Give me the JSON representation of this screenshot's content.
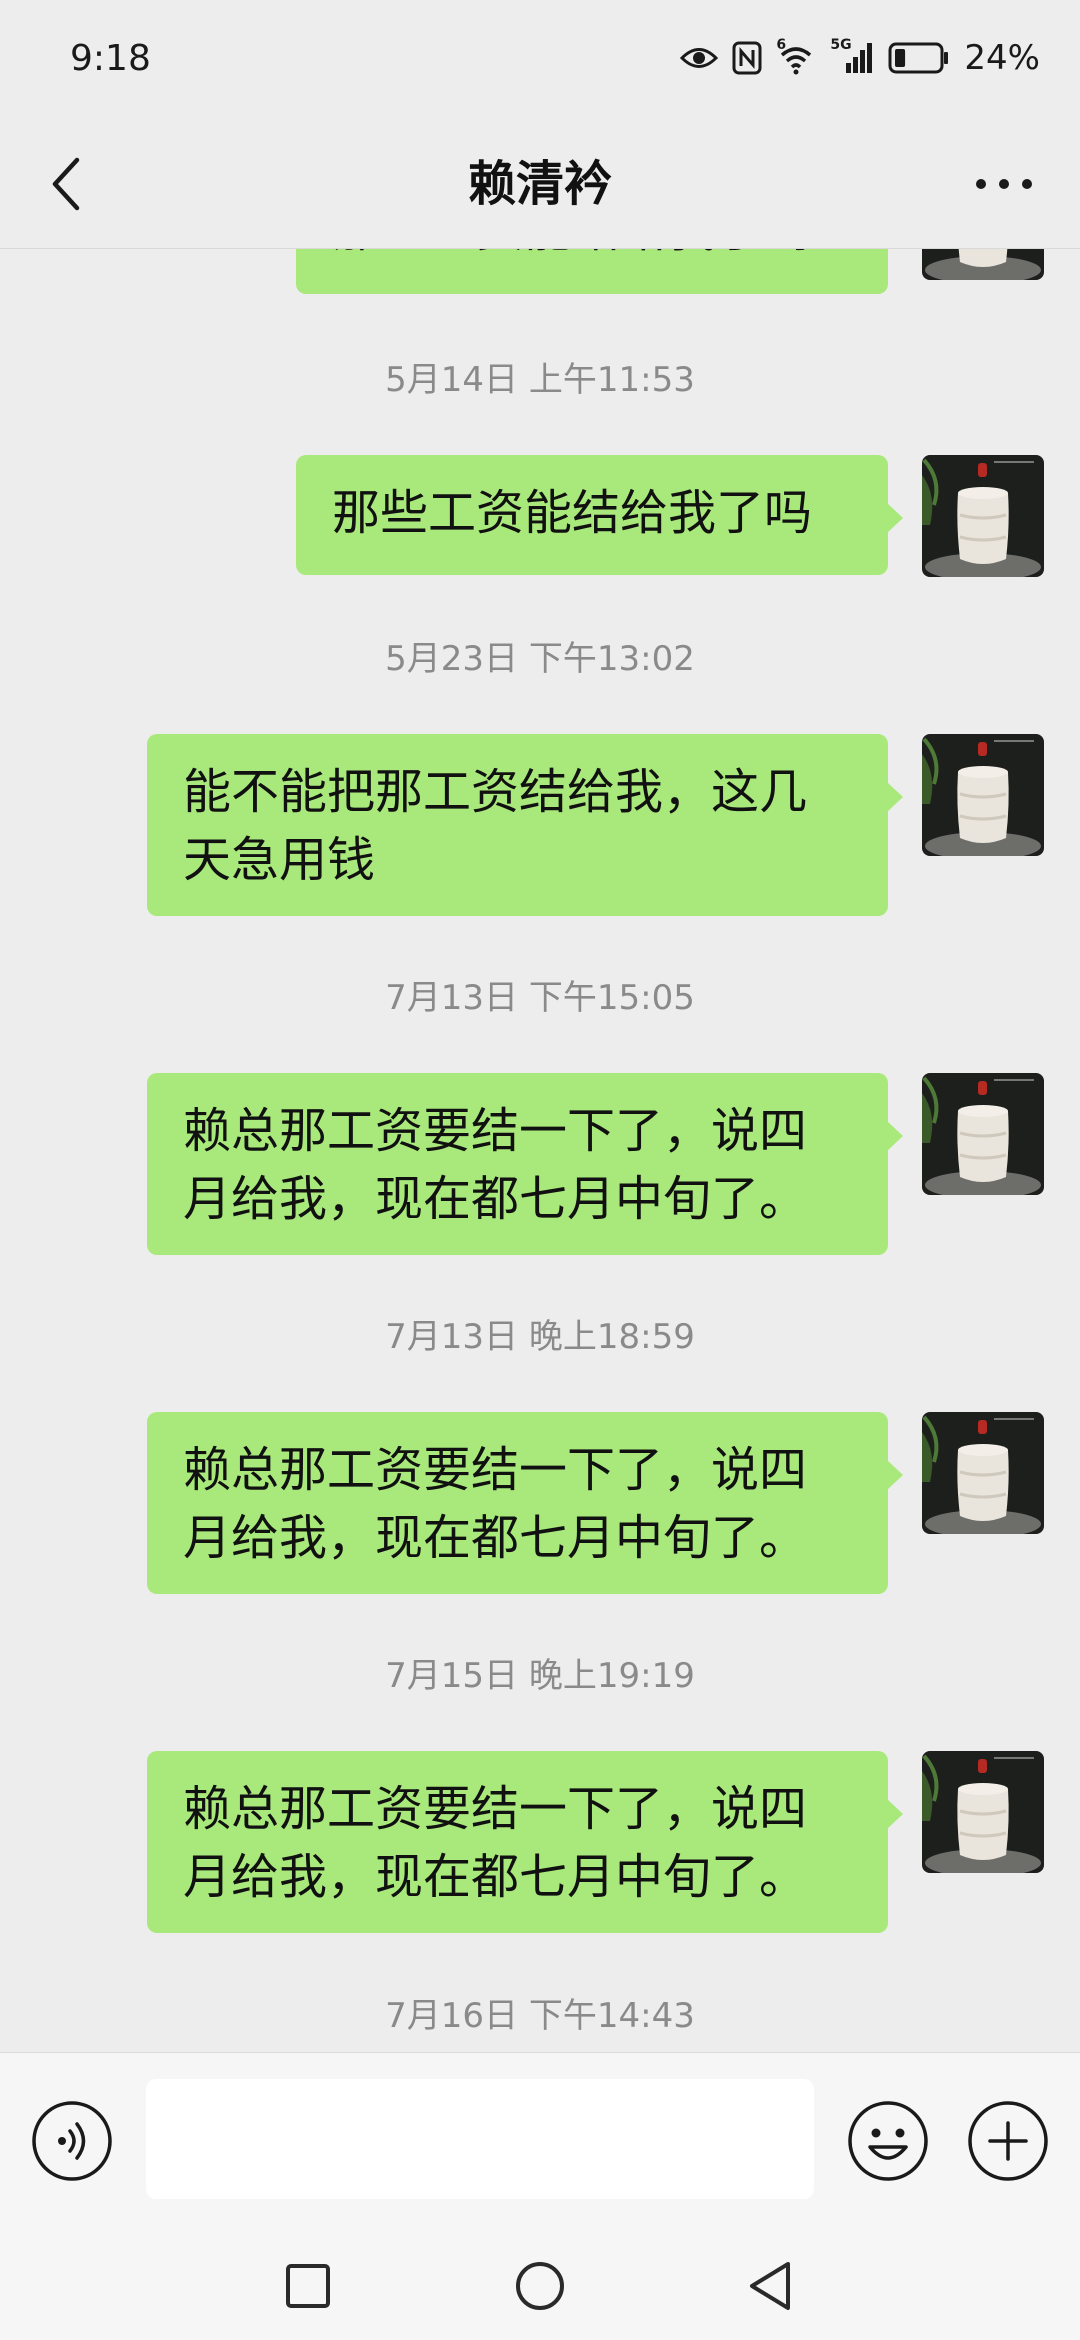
{
  "status_bar": {
    "time": "9:18",
    "network_label": "5G",
    "wifi_label": "6",
    "battery_text": "24%",
    "battery_level": 0.24,
    "icons": [
      "eye-icon",
      "nfc-icon",
      "wifi-icon",
      "signal-icon",
      "battery-icon"
    ]
  },
  "header": {
    "title": "赖清衿",
    "back_icon": "chevron-left-icon",
    "more_icon": "more-dots-icon"
  },
  "messages": [
    {
      "type": "outgoing",
      "text": "那些工资能结给我了吗",
      "partial": true
    },
    {
      "type": "timestamp",
      "text": "5月14日 上午11:53"
    },
    {
      "type": "outgoing",
      "text": "那些工资能结给我了吗"
    },
    {
      "type": "timestamp",
      "text": "5月23日 下午13:02"
    },
    {
      "type": "outgoing",
      "text": "能不能把那工资结给我，这几天急用钱"
    },
    {
      "type": "timestamp",
      "text": "7月13日 下午15:05"
    },
    {
      "type": "outgoing",
      "text": "赖总那工资要结一下了，说四月给我，现在都七月中旬了。"
    },
    {
      "type": "timestamp",
      "text": "7月13日 晚上18:59"
    },
    {
      "type": "outgoing",
      "text": "赖总那工资要结一下了，说四月给我，现在都七月中旬了。"
    },
    {
      "type": "timestamp",
      "text": "7月15日 晚上19:19"
    },
    {
      "type": "outgoing",
      "text": "赖总那工资要结一下了，说四月给我，现在都七月中旬了。"
    },
    {
      "type": "timestamp",
      "text": "7月16日 下午14:43"
    }
  ],
  "input_bar": {
    "value": "",
    "icons": [
      "voice-icon",
      "emoji-icon",
      "plus-icon"
    ]
  },
  "nav_bar": {
    "icons": [
      "recents-square-icon",
      "home-circle-icon",
      "back-triangle-icon"
    ]
  },
  "colors": {
    "background": "#ededed",
    "bubble": "#a9e97c",
    "timestamp": "#8a8a8a"
  }
}
